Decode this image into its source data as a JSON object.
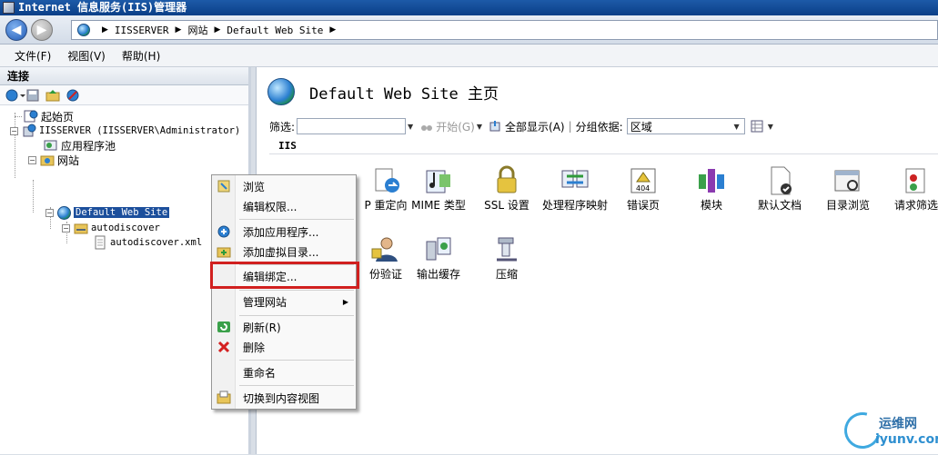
{
  "window": {
    "title": "Internet 信息服务(IIS)管理器"
  },
  "address": {
    "crumbs": [
      "IISSERVER",
      "网站",
      "Default Web Site"
    ]
  },
  "menu": {
    "file": "文件(F)",
    "view": "视图(V)",
    "help": "帮助(H)"
  },
  "connections": {
    "header": "连接",
    "tree": {
      "start_page": "起始页",
      "server": "IISSERVER (IISSERVER\\Administrator)",
      "app_pools": "应用程序池",
      "sites": "网站",
      "default_site": "Default Web Site",
      "autodiscover": "autodiscover",
      "autodiscover_xml": "autodiscover.xml"
    }
  },
  "main": {
    "title": "Default Web Site 主页",
    "filter_label": "筛选:",
    "start_label": "开始(G)",
    "show_all_label": "全部显示(A)",
    "group_by_label": "分组依据:",
    "group_by_value": "区域",
    "section": "IIS",
    "features": [
      {
        "label": "P 重定向",
        "icon": "http-redirect-icon"
      },
      {
        "label": "MIME 类型",
        "icon": "mime-types-icon"
      },
      {
        "label": "SSL 设置",
        "icon": "ssl-lock-icon"
      },
      {
        "label": "处理程序映射",
        "icon": "handler-mappings-icon"
      },
      {
        "label": "错误页",
        "icon": "error-pages-icon"
      },
      {
        "label": "模块",
        "icon": "modules-icon"
      },
      {
        "label": "默认文档",
        "icon": "default-document-icon"
      },
      {
        "label": "目录浏览",
        "icon": "directory-browsing-icon"
      },
      {
        "label": "请求筛选",
        "icon": "request-filtering-icon"
      },
      {
        "label": "份验证",
        "icon": "authentication-icon"
      },
      {
        "label": "输出缓存",
        "icon": "output-caching-icon"
      },
      {
        "label": "压缩",
        "icon": "compression-icon"
      }
    ]
  },
  "context_menu": {
    "browse": "浏览",
    "edit_permissions": "编辑权限...",
    "add_application": "添加应用程序...",
    "add_virtual_directory": "添加虚拟目录...",
    "edit_bindings": "编辑绑定...",
    "manage_website": "管理网站",
    "refresh": "刷新(R)",
    "delete": "删除",
    "rename": "重命名",
    "switch_content_view": "切换到内容视图"
  },
  "watermark": {
    "cn": "运维网",
    "en": "iyunv.com"
  },
  "colors": {
    "title_bar": "#0a3f87",
    "selection": "#1c4f9c",
    "highlight_box": "#d1201f"
  }
}
